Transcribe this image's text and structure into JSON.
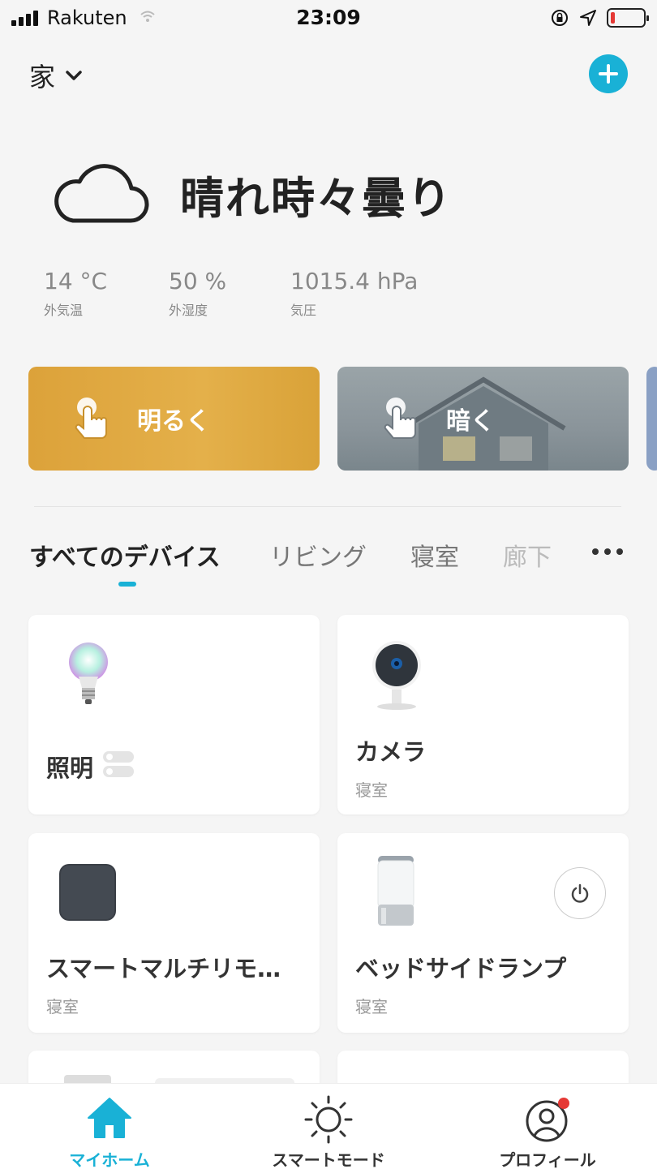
{
  "status_bar": {
    "carrier": "Rakuten",
    "time": "23:09"
  },
  "header": {
    "home_name": "家"
  },
  "weather": {
    "condition": "晴れ時々曇り",
    "icon": "cloud-icon",
    "stats": [
      {
        "value": "14 °C",
        "label": "外気温"
      },
      {
        "value": "50 %",
        "label": "外湿度"
      },
      {
        "value": "1015.4 hPa",
        "label": "気圧"
      }
    ]
  },
  "scenes": [
    {
      "label": "明るく",
      "color": "#e0a93a"
    },
    {
      "label": "暗く",
      "color": "#8e9aa0"
    }
  ],
  "tabs": [
    {
      "label": "すべてのデバイス",
      "active": true
    },
    {
      "label": "リビング"
    },
    {
      "label": "寝室"
    },
    {
      "label": "廊下"
    }
  ],
  "devices": [
    {
      "name": "照明",
      "room": "",
      "icon": "color-bulb-icon"
    },
    {
      "name": "カメラ",
      "room": "寝室",
      "icon": "camera-icon"
    },
    {
      "name": "スマートマルチリモ…",
      "room": "寝室",
      "icon": "remote-hub-icon"
    },
    {
      "name": "ベッドサイドランプ",
      "room": "寝室",
      "icon": "lamp-icon"
    }
  ],
  "bottom_nav": [
    {
      "label": "マイホーム",
      "icon": "home-icon",
      "active": true
    },
    {
      "label": "スマートモード",
      "icon": "sun-icon"
    },
    {
      "label": "プロフィール",
      "icon": "profile-icon"
    }
  ],
  "colors": {
    "accent": "#19b1d6",
    "notification": "#e53935"
  }
}
